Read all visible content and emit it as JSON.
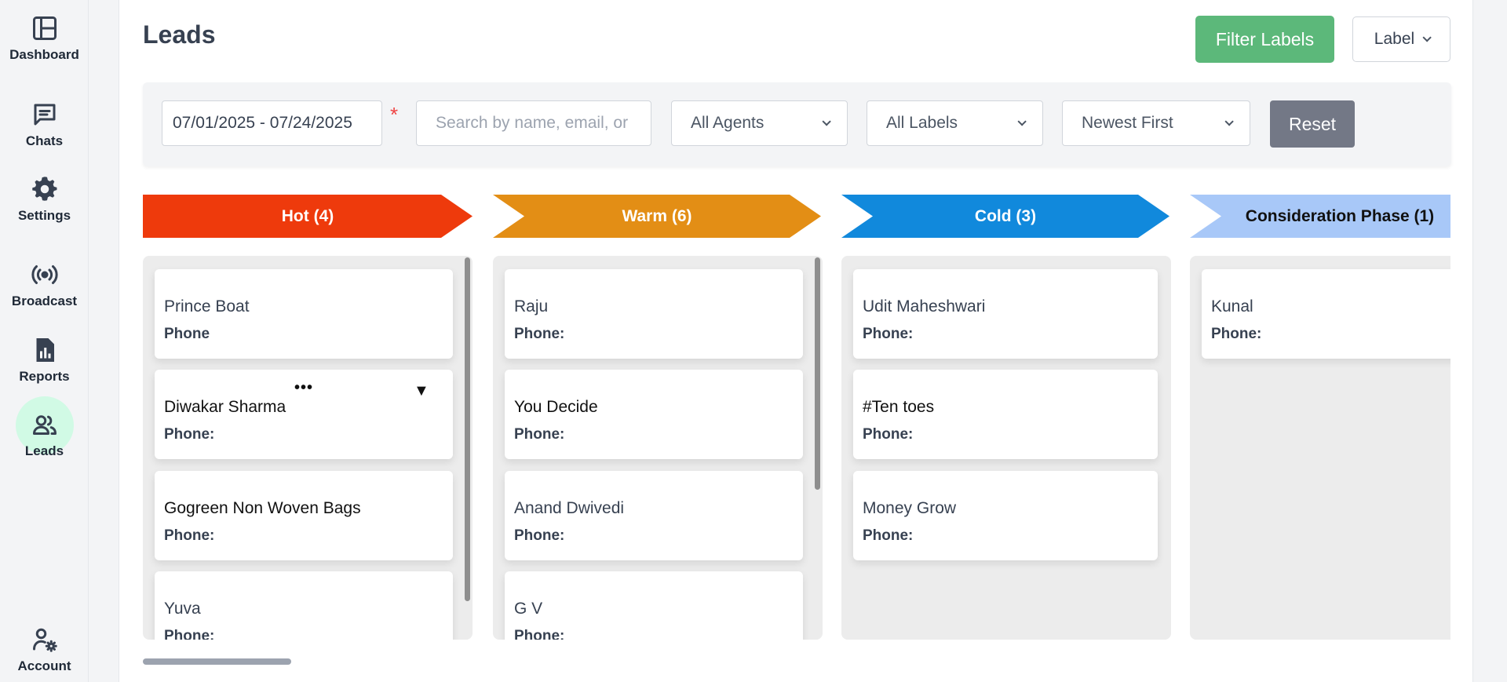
{
  "sidebar": {
    "items": [
      {
        "label": "Dashboard",
        "icon": "layout-icon"
      },
      {
        "label": "Chats",
        "icon": "chat-icon"
      },
      {
        "label": "Settings",
        "icon": "gear-icon"
      },
      {
        "label": "Broadcast",
        "icon": "broadcast-icon"
      },
      {
        "label": "Reports",
        "icon": "report-icon"
      },
      {
        "label": "Leads",
        "icon": "users-icon"
      },
      {
        "label": "Account",
        "icon": "user-settings-icon"
      }
    ],
    "active": "Leads"
  },
  "header": {
    "title": "Leads",
    "filter_labels_button": "Filter Labels",
    "label_dropdown": "Label"
  },
  "filters": {
    "date_range": "07/01/2025 - 07/24/2025",
    "required_mark": "*",
    "search_placeholder": "Search by name, email, or phone",
    "agents": "All Agents",
    "labels": "All Labels",
    "sort": "Newest First",
    "reset_button": "Reset"
  },
  "columns": [
    {
      "title": "Hot (4)",
      "color": "#ee3a0c",
      "cards": [
        {
          "name": "Prince Boat",
          "phone_label": "Phone"
        },
        {
          "name": "Diwakar Sharma",
          "phone_label": "Phone:",
          "menu": "•••",
          "caret": "▼"
        },
        {
          "name": "Gogreen Non Woven Bags",
          "phone_label": "Phone:"
        },
        {
          "name": "Yuva",
          "phone_label": "Phone:"
        }
      ]
    },
    {
      "title": "Warm (6)",
      "color": "#e38e15",
      "cards": [
        {
          "name": "Raju",
          "phone_label": "Phone:"
        },
        {
          "name": "You Decide",
          "phone_label": "Phone:"
        },
        {
          "name": "Anand Dwivedi",
          "phone_label": "Phone:"
        },
        {
          "name": "G V",
          "phone_label": "Phone:"
        }
      ]
    },
    {
      "title": "Cold (3)",
      "color": "#1189dc",
      "cards": [
        {
          "name": "Udit Maheshwari",
          "phone_label": "Phone:"
        },
        {
          "name": "#Ten toes",
          "phone_label": "Phone:"
        },
        {
          "name": "Money Grow",
          "phone_label": "Phone:"
        }
      ]
    },
    {
      "title": "Consideration Phase (1)",
      "color": "#a8c8f8",
      "cards": [
        {
          "name": "Kunal",
          "phone_label": "Phone:"
        }
      ]
    }
  ]
}
